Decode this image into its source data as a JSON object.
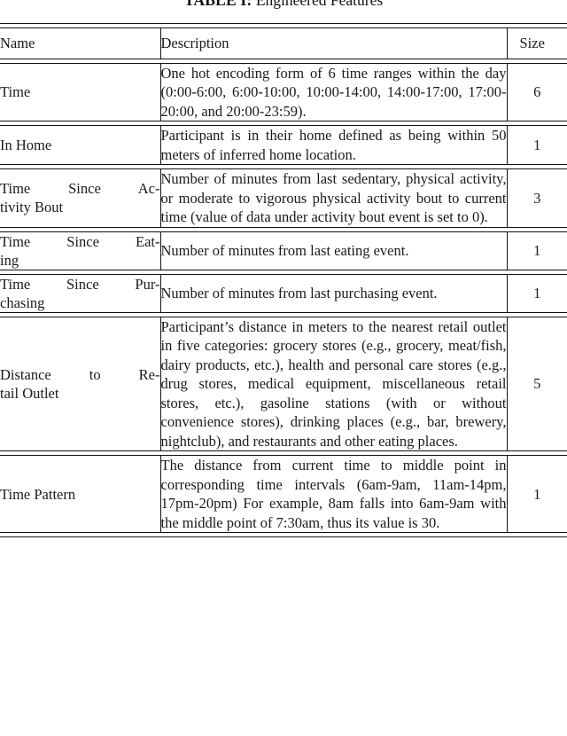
{
  "caption": {
    "label": "TABLE I:",
    "text": "Engineered Features"
  },
  "table": {
    "columns": [
      "Name",
      "Description",
      "Size"
    ],
    "rows": [
      {
        "name": "Time",
        "name_lines": [
          "Time"
        ],
        "description": "One hot encoding form of 6 time ranges within the day (0:00-6:00, 6:00-10:00, 10:00-14:00, 14:00-17:00, 17:00-20:00, and 20:00-23:59).",
        "size": "6"
      },
      {
        "name": "In Home",
        "name_lines": [
          "In Home"
        ],
        "description": "Participant is in their home defined as being within 50 meters of inferred home location.",
        "size": "1"
      },
      {
        "name": "Time Since Activity Bout",
        "name_lines": [
          "Time Since Ac-",
          "tivity Bout"
        ],
        "description": "Number of minutes from last sedentary, physical activity, or moderate to vigorous physical activity bout to current time (value of data under activity bout event is set to 0).",
        "size": "3"
      },
      {
        "name": "Time Since Eating",
        "name_lines": [
          "Time Since Eat-",
          "ing"
        ],
        "description": "Number of minutes from last eating event.",
        "size": "1"
      },
      {
        "name": "Time Since Purchasing",
        "name_lines": [
          "Time Since Pur-",
          "chasing"
        ],
        "description": "Number of minutes from last purchasing event.",
        "size": "1"
      },
      {
        "name": "Distance to Retail Outlet",
        "name_lines": [
          "Distance to Re-",
          "tail Outlet"
        ],
        "description": "Participant’s distance in meters to the nearest retail outlet in five categories: grocery stores (e.g., grocery, meat/fish, dairy products, etc.), health and personal care stores (e.g., drug stores, medical equipment, miscellaneous retail stores, etc.), gasoline stations (with or without convenience stores), drinking places (e.g., bar, brewery, nightclub), and restaurants and other eating places.",
        "size": "5"
      },
      {
        "name": "Time Pattern",
        "name_lines": [
          "Time Pattern"
        ],
        "description": "The distance from current time to middle point in corresponding time intervals (6am-9am, 11am-14pm, 17pm-20pm) For example, 8am falls into 6am-9am with the middle point of 7:30am, thus its value is 30.",
        "size": "1"
      }
    ]
  },
  "style": {
    "rule_color": "#111111",
    "text_color": "#1a1a1a",
    "background": "#ffffff"
  }
}
